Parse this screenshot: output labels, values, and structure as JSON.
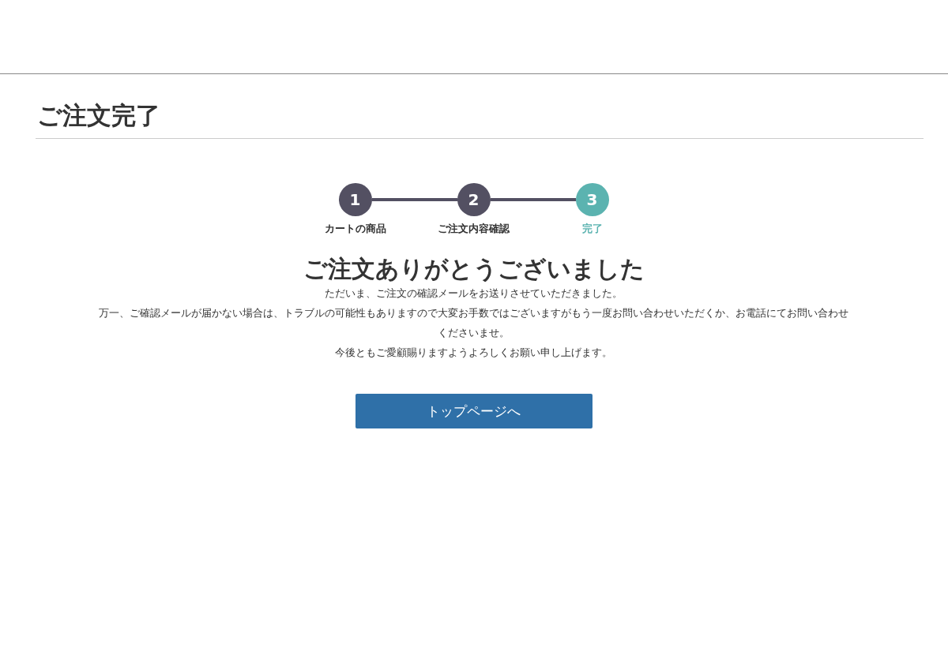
{
  "page_title": "ご注文完了",
  "steps": [
    {
      "number": "1",
      "label": "カートの商品",
      "selected": false
    },
    {
      "number": "2",
      "label": "ご注文内容確認",
      "selected": false
    },
    {
      "number": "3",
      "label": "完了",
      "selected": true
    }
  ],
  "heading": "ご注文ありがとうございました",
  "messages": [
    "ただいま、ご注文の確認メールをお送りさせていただきました。",
    "万一、ご確認メールが届かない場合は、トラブルの可能性もありますので大変お手数ではございますがもう一度お問い合わせいただくか、お電話にてお問い合わせくださいませ。",
    "今後ともご愛顧賜りますようよろしくお願い申し上げます。"
  ],
  "button": "トップページへ"
}
